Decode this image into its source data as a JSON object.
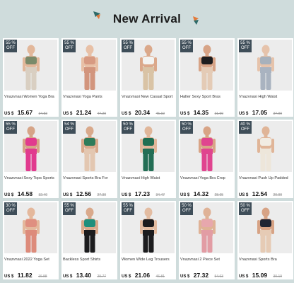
{
  "header": {
    "title": "New Arrival"
  },
  "currency": "US $",
  "products": [
    {
      "name": "Vnazvnasi Women Yoga Bra",
      "price": "15.67",
      "old_price": "34.83",
      "pct": "55",
      "off": "OFF",
      "top": "#7a8a6a",
      "bottom": "#d9cfc2",
      "skin": "#e2b79a"
    },
    {
      "name": "Vnazvnasi Yoga Pants",
      "price": "21.24",
      "old_price": "47.20",
      "pct": "55",
      "off": "OFF",
      "top": "#d79a82",
      "bottom": "#d2957d",
      "skin": "#e8c0a6"
    },
    {
      "name": "Vnazvnasi New Casual Sport",
      "price": "20.34",
      "old_price": "45.19",
      "pct": "55",
      "off": "OFF",
      "top": "#f3f3f1",
      "bottom": "#d9c3a5",
      "skin": "#dba88a"
    },
    {
      "name": "Halter Sexy Sport Bras",
      "price": "14.35",
      "old_price": "31.90",
      "pct": "55",
      "off": "OFF",
      "top": "#1d1d1f",
      "bottom": "#e4cbb6",
      "skin": "#d7a386"
    },
    {
      "name": "Vnazvnasi High Waist",
      "price": "17.05",
      "old_price": "37.90",
      "pct": "55",
      "off": "OFF",
      "top": "#a7b1bc",
      "bottom": "#a9b3c0",
      "skin": "#e6c3ab"
    },
    {
      "name": "Vnazvnasi Sexy Tops Sports",
      "price": "14.58",
      "old_price": "32.40",
      "pct": "55",
      "off": "OFF",
      "top": "#e13a8e",
      "bottom": "#e13a8e",
      "skin": "#d6a487"
    },
    {
      "name": "Vnazvnasi Sports Bra For",
      "price": "12.56",
      "old_price": "27.30",
      "pct": "54",
      "off": "OFF",
      "top": "#2e7c5a",
      "bottom": "#e3c7b1",
      "skin": "#d9a98b"
    },
    {
      "name": "Vnazvnasi High Waist",
      "price": "17.23",
      "old_price": "34.47",
      "pct": "50",
      "off": "OFF",
      "top": "#1f6e52",
      "bottom": "#236e55",
      "skin": "#e0b699"
    },
    {
      "name": "Vnazvnasi Yoga Bra Crop",
      "price": "14.32",
      "old_price": "28.65",
      "pct": "50",
      "off": "OFF",
      "top": "#e0448f",
      "bottom": "#e0448f",
      "skin": "#d8a486"
    },
    {
      "name": "Vnazvnasi Push Up Padded",
      "price": "12.54",
      "old_price": "20.90",
      "pct": "40",
      "off": "OFF",
      "top": "#f1ece3",
      "bottom": "#ede6da",
      "skin": "#e0b598"
    },
    {
      "name": "Vnazvnasi 2022 Yoga Set",
      "price": "11.82",
      "old_price": "16.88",
      "pct": "30",
      "off": "OFF",
      "top": "#df8f80",
      "bottom": "#dd8b7b",
      "skin": "#e4b89c"
    },
    {
      "name": "Backless Sport Shirts",
      "price": "13.40",
      "old_price": "29.77",
      "pct": "55",
      "off": "OFF",
      "top": "#1f8f7c",
      "bottom": "#1c1c1e",
      "skin": "#d9a98b"
    },
    {
      "name": "Women Wide Leg Trousers",
      "price": "21.06",
      "old_price": "46.81",
      "pct": "55",
      "off": "OFF",
      "top": "#1c1c1e",
      "bottom": "#1c1c1e",
      "skin": "#e3bca1"
    },
    {
      "name": "Vnazvnasi 2 Piece Set",
      "price": "27.32",
      "old_price": "54.63",
      "pct": "50",
      "off": "OFF",
      "top": "#e7a7ad",
      "bottom": "#e29ca4",
      "skin": "#dfb296"
    },
    {
      "name": "Vnazvnasi Sports Bra",
      "price": "15.09",
      "old_price": "30.19",
      "pct": "50",
      "off": "OFF",
      "top": "#1f2433",
      "bottom": "#e6cbb5",
      "skin": "#d7a385"
    }
  ]
}
